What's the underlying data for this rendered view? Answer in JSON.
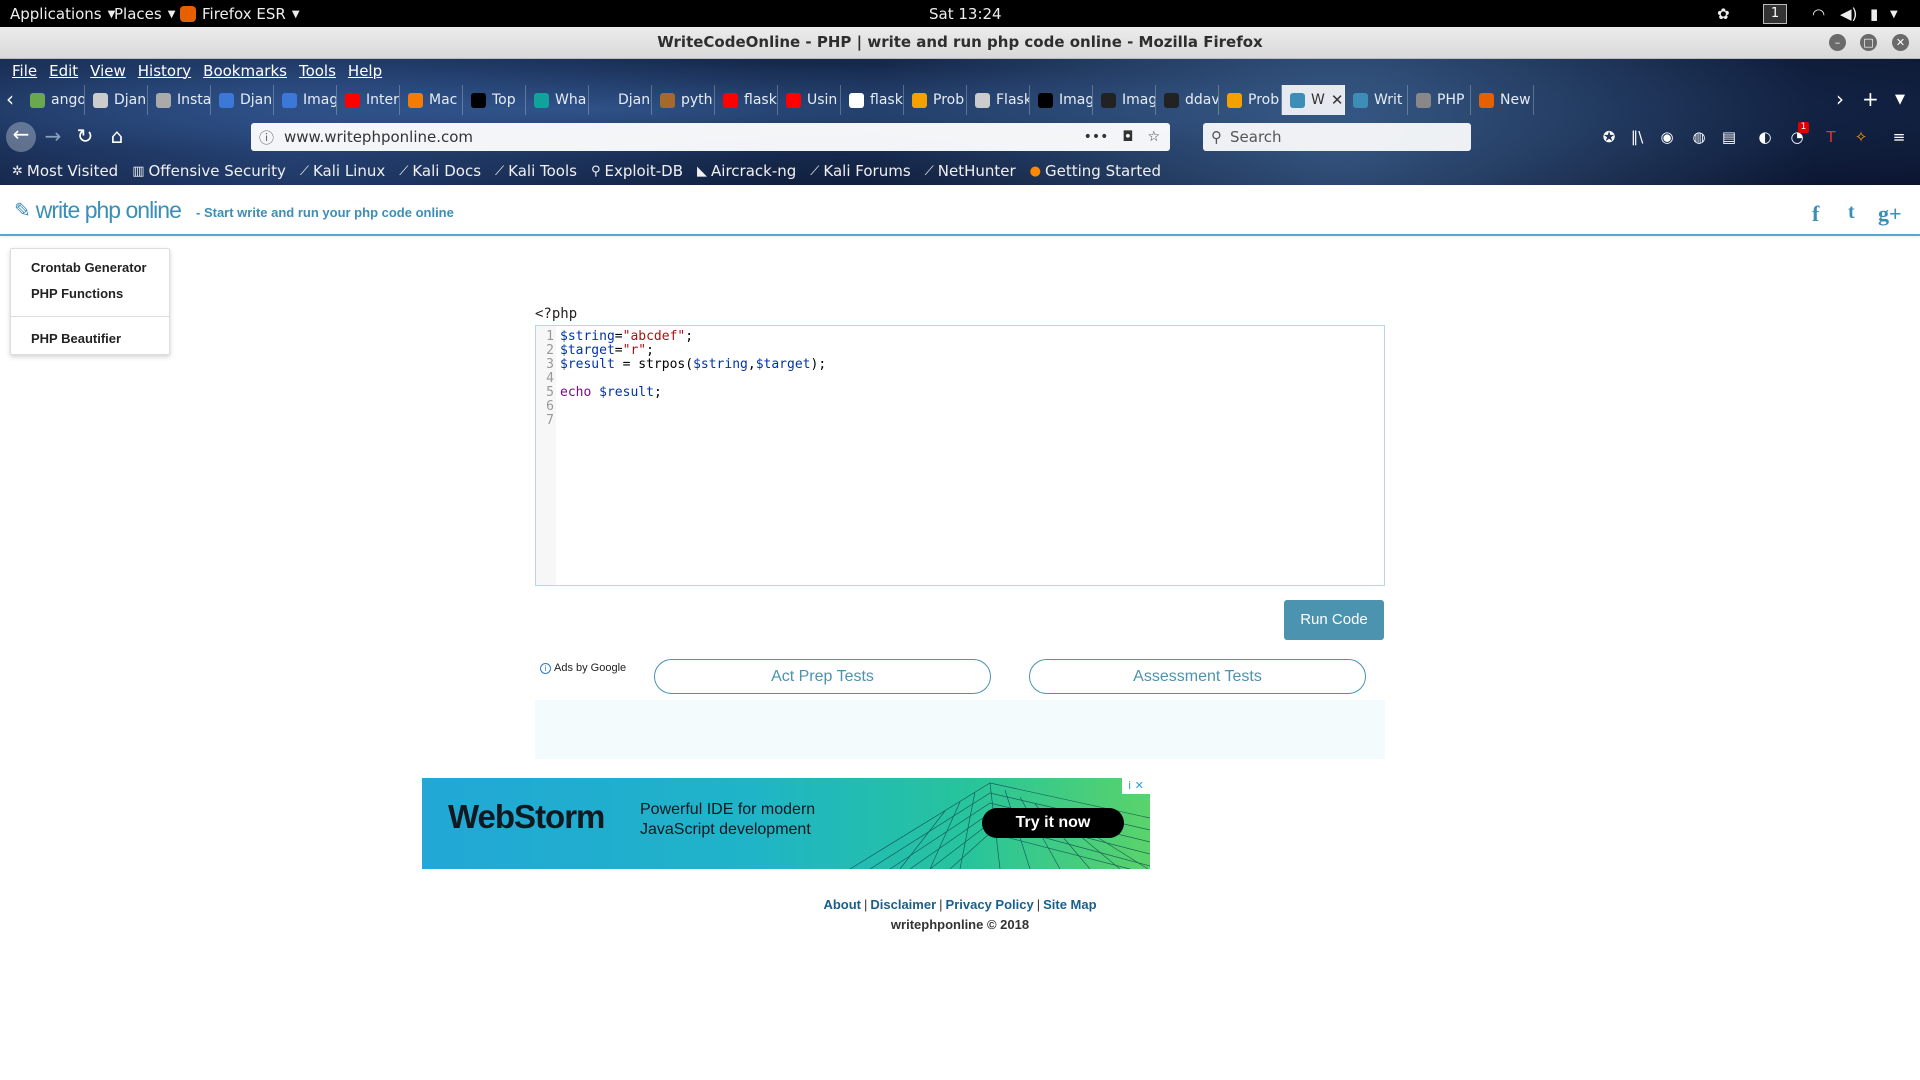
{
  "topbar": {
    "applications": "Applications",
    "places": "Places",
    "firefox": "Firefox ESR",
    "clock": "Sat 13:24",
    "workspace": "1"
  },
  "window": {
    "title": "WriteCodeOnline - PHP | write and run php code online - Mozilla Firefox"
  },
  "menubar": [
    "File",
    "Edit",
    "View",
    "History",
    "Bookmarks",
    "Tools",
    "Help"
  ],
  "tabs": [
    {
      "label": "ango",
      "color": "#6aa84f"
    },
    {
      "label": "Djan",
      "color": "#cccccc"
    },
    {
      "label": "Insta",
      "color": "#aaaaaa"
    },
    {
      "label": "Djan",
      "color": "#3c78d8"
    },
    {
      "label": "Imag",
      "color": "#3c78d8"
    },
    {
      "label": "Inter",
      "color": "#ff0000"
    },
    {
      "label": "Mac",
      "color": "#f57c00"
    },
    {
      "label": "Top",
      "color": "#000000"
    },
    {
      "label": "Wha",
      "color": "#11a39b"
    },
    {
      "label": "Django",
      "color": "#00000000"
    },
    {
      "label": "pyth",
      "color": "#a56a2b"
    },
    {
      "label": "flask",
      "color": "#ff0000"
    },
    {
      "label": "Usin",
      "color": "#ff0000"
    },
    {
      "label": "flask",
      "color": "#ffffff"
    },
    {
      "label": "Prob",
      "color": "#f4a100"
    },
    {
      "label": "Flask",
      "color": "#cccccc"
    },
    {
      "label": "Imag",
      "color": "#000000"
    },
    {
      "label": "Imag",
      "color": "#222222"
    },
    {
      "label": "ddav",
      "color": "#222222"
    },
    {
      "label": "Prob",
      "color": "#f4a100"
    },
    {
      "label": "W",
      "color": "#3c8eb6",
      "active": true
    },
    {
      "label": "Writ",
      "color": "#3c8eb6"
    },
    {
      "label": "PHP",
      "color": "#888888"
    },
    {
      "label": "New",
      "color": "#e66000"
    }
  ],
  "nav": {
    "url": "www.writephponline.com",
    "search_placeholder": "Search",
    "notification_count": "1"
  },
  "bookmarks": [
    "Most Visited",
    "Offensive Security",
    "Kali Linux",
    "Kali Docs",
    "Kali Tools",
    "Exploit-DB",
    "Aircrack-ng",
    "Kali Forums",
    "NetHunter",
    "Getting Started"
  ],
  "site": {
    "logo": "write php online",
    "tagline": "-  Start write and run your php code online",
    "social": {
      "facebook": "f",
      "twitter": "t",
      "google": "g+"
    }
  },
  "side_menu": {
    "items": [
      "Crontab Generator",
      "PHP Functions",
      "PHP Beautifier"
    ]
  },
  "editor": {
    "open_tag": "<?php",
    "lines": [
      {
        "n": "1",
        "code": [
          {
            "t": "$string",
            "c": "v"
          },
          {
            "t": "=",
            "c": "f"
          },
          {
            "t": "\"abcdef\"",
            "c": "s"
          },
          {
            "t": ";",
            "c": "f"
          }
        ]
      },
      {
        "n": "2",
        "code": [
          {
            "t": "$target",
            "c": "v"
          },
          {
            "t": "=",
            "c": "f"
          },
          {
            "t": "\"r\"",
            "c": "s"
          },
          {
            "t": ";",
            "c": "f"
          }
        ]
      },
      {
        "n": "3",
        "code": [
          {
            "t": "$result",
            "c": "v"
          },
          {
            "t": " = ",
            "c": "f"
          },
          {
            "t": "strpos",
            "c": "f"
          },
          {
            "t": "(",
            "c": "f"
          },
          {
            "t": "$string",
            "c": "v"
          },
          {
            "t": ",",
            "c": "f"
          },
          {
            "t": "$target",
            "c": "v"
          },
          {
            "t": ");",
            "c": "f"
          }
        ]
      },
      {
        "n": "4",
        "code": []
      },
      {
        "n": "5",
        "code": [
          {
            "t": "echo",
            "c": "k"
          },
          {
            "t": " ",
            "c": "f"
          },
          {
            "t": "$result",
            "c": "v"
          },
          {
            "t": ";",
            "c": "f"
          }
        ]
      },
      {
        "n": "6",
        "code": []
      },
      {
        "n": "7",
        "code": []
      }
    ]
  },
  "run_button": "Run Code",
  "ads": {
    "ads_by": "Ads by Google",
    "pill_left": "Act Prep Tests",
    "pill_right": "Assessment Tests"
  },
  "banner": {
    "brand": "WebStorm",
    "copy": "Powerful IDE for modern JavaScript development",
    "cta": "Try it now",
    "adx": "i ✕"
  },
  "footer": {
    "links": [
      "About",
      "Disclaimer",
      "Privacy Policy",
      "Site Map"
    ],
    "copyright": "writephponline © 2018"
  },
  "colors": {
    "accent": "#3c8eb6",
    "run_button": "#4b93ae"
  }
}
